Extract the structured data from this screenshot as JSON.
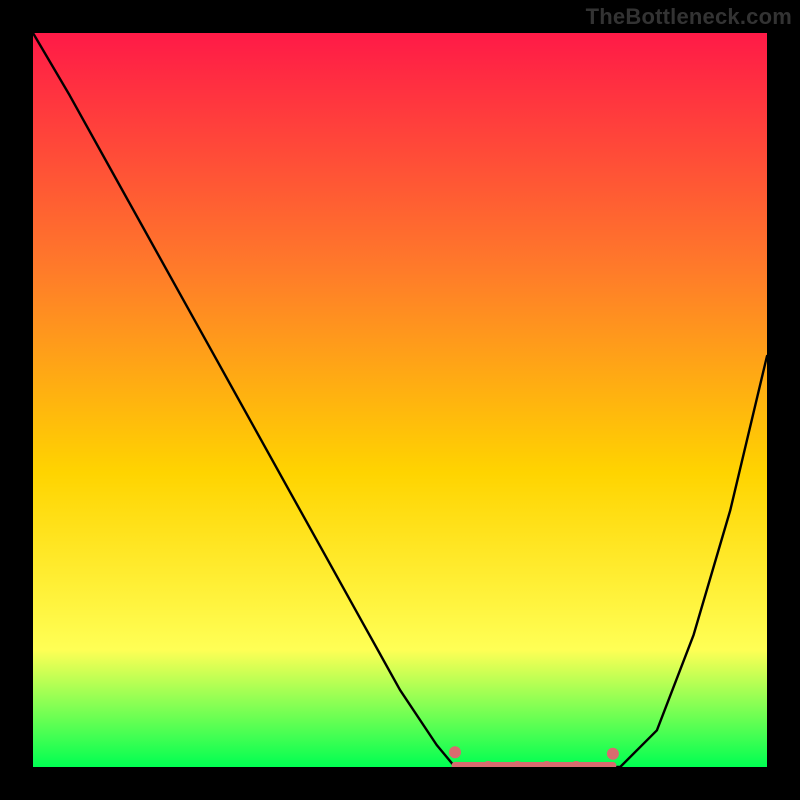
{
  "watermark": "TheBottleneck.com",
  "colors": {
    "frame": "#000000",
    "gradient_top": "#ff1a47",
    "gradient_mid_upper": "#ff7a2a",
    "gradient_mid": "#ffd400",
    "gradient_lower": "#ffff55",
    "gradient_bottom": "#00ff52",
    "curve": "#000000",
    "markers": "#d86b6f",
    "segment": "#d86b6f"
  },
  "chart_data": {
    "type": "line",
    "title": "",
    "xlabel": "",
    "ylabel": "",
    "x": [
      0.0,
      0.05,
      0.1,
      0.15,
      0.2,
      0.25,
      0.3,
      0.35,
      0.4,
      0.45,
      0.5,
      0.55,
      0.575,
      0.6,
      0.65,
      0.7,
      0.75,
      0.8,
      0.85,
      0.9,
      0.95,
      1.0
    ],
    "y": [
      1.0,
      0.915,
      0.825,
      0.735,
      0.645,
      0.555,
      0.465,
      0.375,
      0.285,
      0.195,
      0.105,
      0.03,
      0.0,
      0.0,
      0.0,
      0.0,
      0.0,
      0.0,
      0.05,
      0.18,
      0.35,
      0.56
    ],
    "xlim": [
      0,
      1
    ],
    "ylim": [
      0,
      1
    ],
    "markers": [
      {
        "x": 0.575,
        "y": 0.02
      },
      {
        "x": 0.62,
        "y": 0.0
      },
      {
        "x": 0.66,
        "y": 0.0
      },
      {
        "x": 0.7,
        "y": 0.0
      },
      {
        "x": 0.74,
        "y": 0.0
      },
      {
        "x": 0.79,
        "y": 0.018
      }
    ],
    "bottom_segment": {
      "x1": 0.575,
      "x2": 0.79,
      "y": 0.002
    }
  }
}
